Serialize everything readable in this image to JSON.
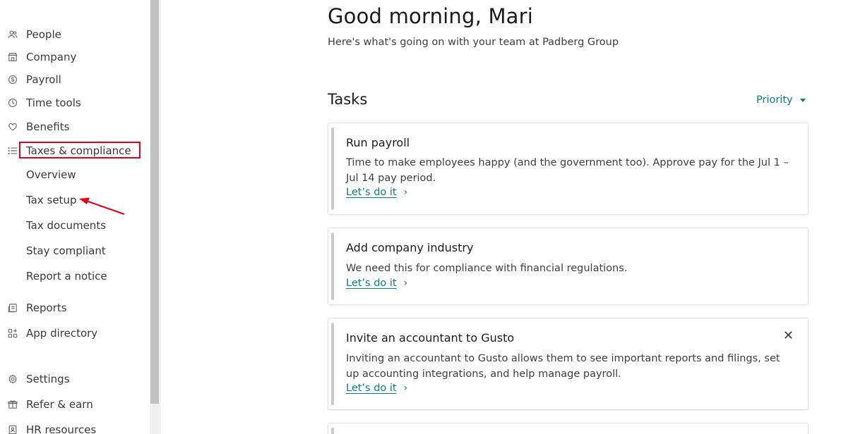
{
  "sidebar": {
    "items": [
      {
        "label": "People",
        "icon": "people-icon"
      },
      {
        "label": "Company",
        "icon": "company-icon"
      },
      {
        "label": "Payroll",
        "icon": "payroll-icon"
      },
      {
        "label": "Time tools",
        "icon": "clock-icon"
      },
      {
        "label": "Benefits",
        "icon": "heart-icon"
      },
      {
        "label": "Taxes & compliance",
        "icon": "list-icon"
      }
    ],
    "sub_items": [
      {
        "label": "Overview"
      },
      {
        "label": "Tax setup"
      },
      {
        "label": "Tax documents"
      },
      {
        "label": "Stay compliant"
      },
      {
        "label": "Report a notice"
      }
    ],
    "lower_items": [
      {
        "label": "Reports",
        "icon": "reports-icon"
      },
      {
        "label": "App directory",
        "icon": "apps-icon"
      }
    ],
    "bottom_items": [
      {
        "label": "Settings",
        "icon": "gear-icon"
      },
      {
        "label": "Refer & earn",
        "icon": "gift-icon"
      },
      {
        "label": "HR resources",
        "icon": "hr-resources-icon"
      }
    ]
  },
  "header": {
    "greeting": "Good morning, Mari",
    "subtitle": "Here's what's going on with your team at Padberg Group"
  },
  "tasks": {
    "title": "Tasks",
    "sort_label": "Priority",
    "cta_label": "Let’s do it",
    "cards": [
      {
        "title": "Run payroll",
        "description": "Time to make employees happy (and the government too). Approve pay for the Jul 1 – Jul 14 pay period."
      },
      {
        "title": "Add company industry",
        "description": "We need this for compliance with financial regulations."
      },
      {
        "title": "Invite an accountant to Gusto",
        "description": "Inviting an accountant to Gusto allows them to see important reports and filings, set up accounting integrations, and help manage payroll."
      }
    ]
  },
  "colors": {
    "accent": "#0a8080",
    "highlight": "#e3001b"
  }
}
